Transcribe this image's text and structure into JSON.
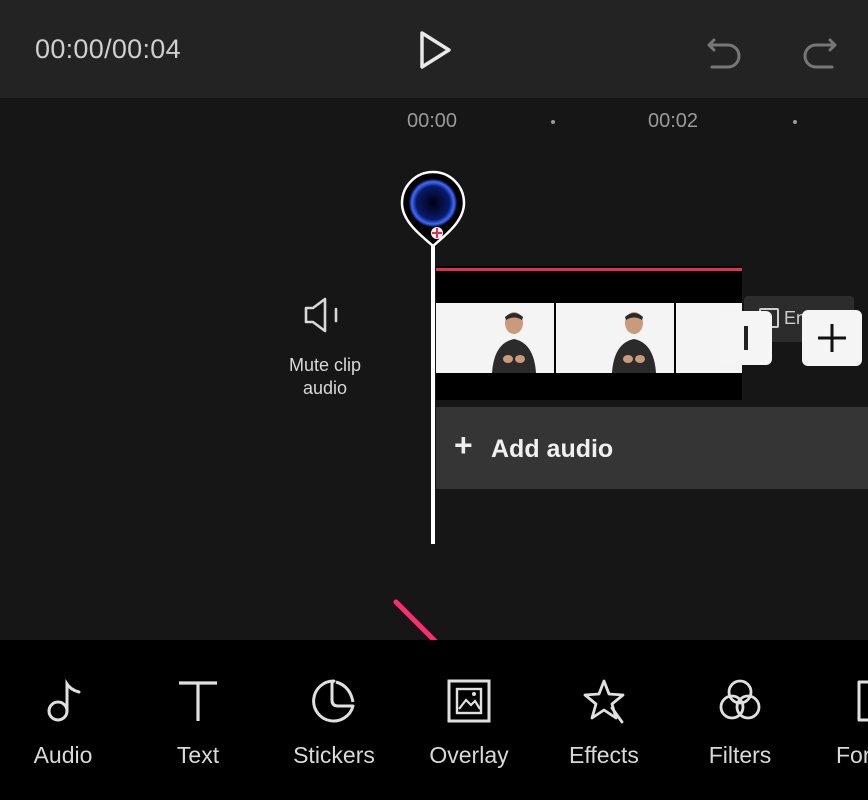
{
  "header": {
    "timecode": "00:00/00:04",
    "play_icon": "play-icon",
    "undo_icon": "undo-icon",
    "redo_icon": "redo-icon"
  },
  "timeline": {
    "ruler": [
      "00:00",
      "00:02"
    ],
    "mute": {
      "icon": "speaker-icon",
      "label_line1": "Mute clip",
      "label_line2": "audio"
    },
    "ending_label": "En",
    "add_audio": {
      "plus": "+",
      "label": "Add audio"
    }
  },
  "toolbar": {
    "items": [
      {
        "label": "Audio",
        "icon": "music-note-icon"
      },
      {
        "label": "Text",
        "icon": "text-icon"
      },
      {
        "label": "Stickers",
        "icon": "sticker-icon"
      },
      {
        "label": "Overlay",
        "icon": "overlay-icon"
      },
      {
        "label": "Effects",
        "icon": "effects-star-icon"
      },
      {
        "label": "Filters",
        "icon": "filters-icon"
      },
      {
        "label": "For",
        "icon": "format-icon"
      }
    ]
  },
  "colors": {
    "accent_red": "#e0304e",
    "arrow": "#ff2d6f"
  }
}
